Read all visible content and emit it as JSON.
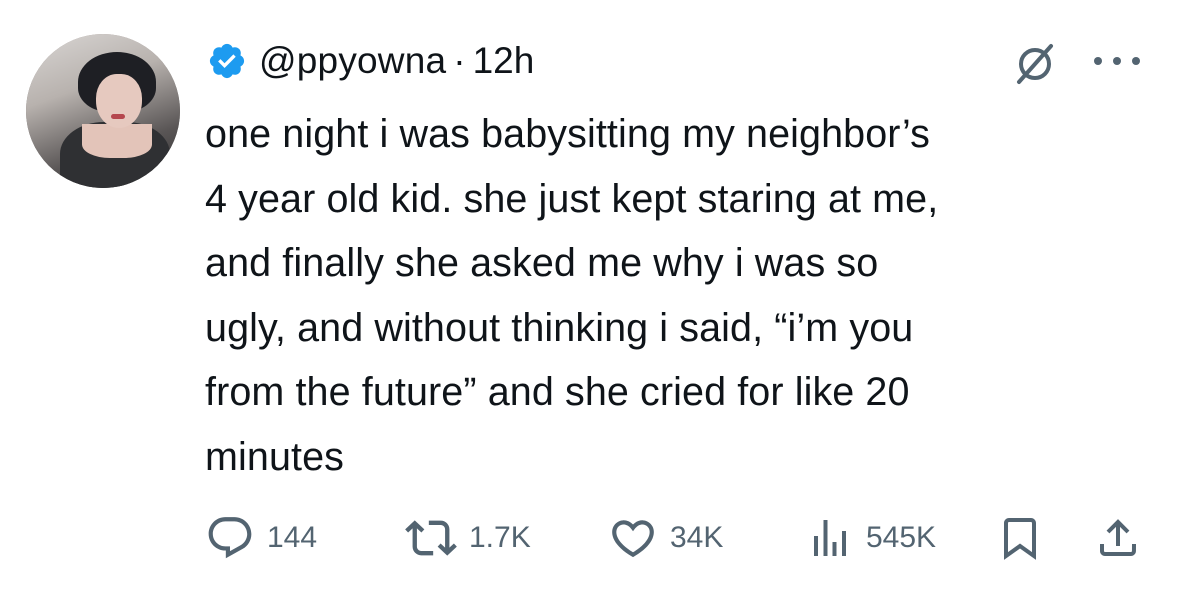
{
  "tweet": {
    "handle": "@ppyowna",
    "separator": "·",
    "time": "12h",
    "text": "one night i was babysitting my neighbor’s\n4 year old kid. she just kept staring at me,\nand finally she asked me why i was so\nugly, and without thinking i said, “i’m you\nfrom the future” and she cried for like 20\nminutes"
  },
  "metrics": {
    "replies": "144",
    "reposts": "1.7K",
    "likes": "34K",
    "views": "545K"
  },
  "icons": {
    "verified": "verified-badge-icon",
    "grok": "grok-icon",
    "more": "more-icon",
    "reply": "reply-icon",
    "repost": "repost-icon",
    "like": "heart-icon",
    "views": "views-icon",
    "bookmark": "bookmark-icon",
    "share": "share-icon"
  },
  "colors": {
    "verified_blue": "#1d9bf0",
    "text": "#0f1419",
    "secondary": "#536471"
  }
}
